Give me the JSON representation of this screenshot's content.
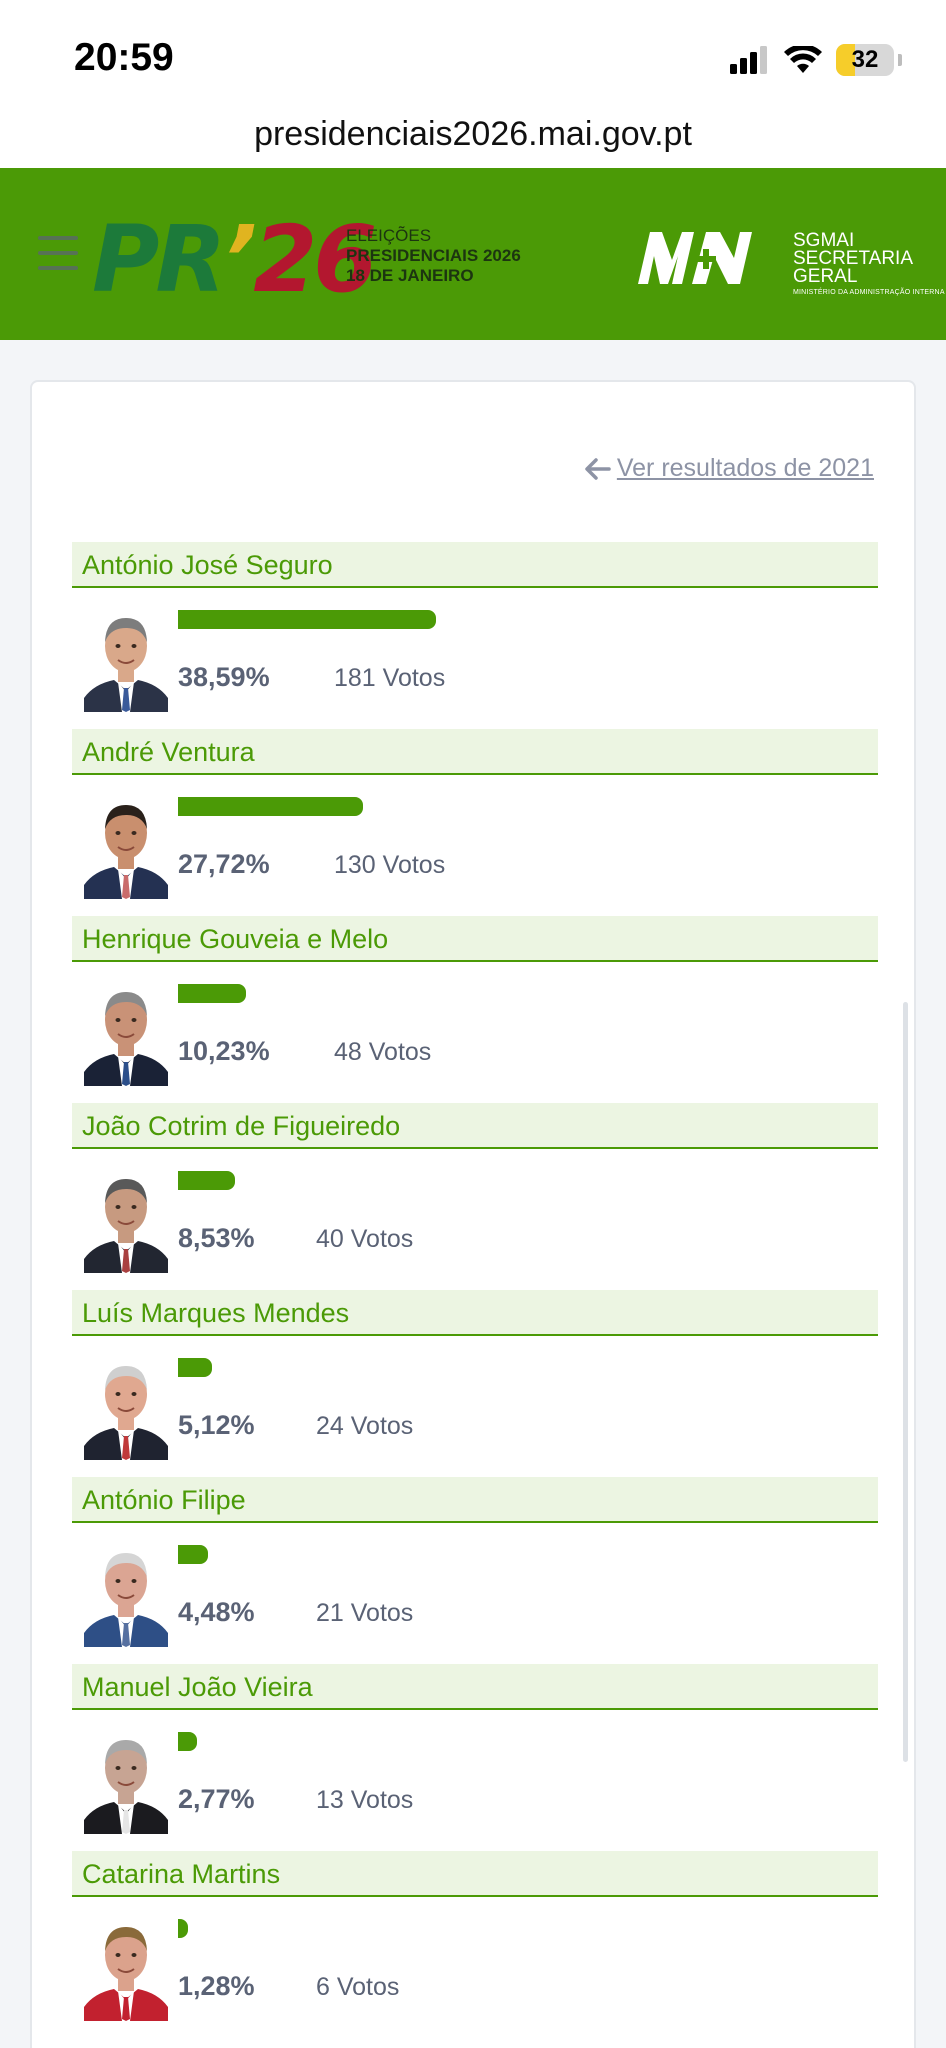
{
  "status_bar": {
    "time": "20:59",
    "battery": "32",
    "battery_level": 0.32
  },
  "url": "presidenciais2026.mai.gov.pt",
  "header": {
    "logo_pr": "PR",
    "logo_apostrophe": "’",
    "logo_year": "26",
    "logo_line1": "ELEIÇÕES",
    "logo_line2": "PRESIDENCIAIS 2026",
    "logo_line3": "18 DE JANEIRO",
    "sgmai_line1": "SGMAI",
    "sgmai_line2": "SECRETARIA",
    "sgmai_line3": "GERAL",
    "sgmai_line4": "MINISTÉRIO DA ADMINISTRAÇÃO INTERNA",
    "brand_color": "#4b9a06"
  },
  "back_link": "Ver resultados de 2021",
  "candidates": [
    {
      "name": "António José Seguro",
      "percent": "38,59%",
      "votes": "181 Votos",
      "share": 38.59,
      "suit": "#2b3347",
      "skin": "#d9a88a",
      "hair": "#7d7d7d",
      "tie": "#3a5a9a"
    },
    {
      "name": "André Ventura",
      "percent": "27,72%",
      "votes": "130 Votos",
      "share": 27.72,
      "suit": "#243152",
      "skin": "#c98f6e",
      "hair": "#2a211b",
      "tie": "#c96b6b"
    },
    {
      "name": "Henrique Gouveia e Melo",
      "percent": "10,23%",
      "votes": "48 Votos",
      "share": 10.23,
      "suit": "#1a2236",
      "skin": "#c99277",
      "hair": "#8a8a8a",
      "tie": "#2c4f8a"
    },
    {
      "name": "João Cotrim de Figueiredo",
      "percent": "8,53%",
      "votes": "40 Votos",
      "share": 8.53,
      "suit": "#222631",
      "skin": "#c79a80",
      "hair": "#595959",
      "tie": "#a94040"
    },
    {
      "name": "Luís Marques Mendes",
      "percent": "5,12%",
      "votes": "24 Votos",
      "share": 5.12,
      "suit": "#1f2330",
      "skin": "#e0a890",
      "hair": "#cfcfcf",
      "tie": "#c0393a"
    },
    {
      "name": "António Filipe",
      "percent": "4,48%",
      "votes": "21 Votos",
      "share": 4.48,
      "suit": "#2e4f86",
      "skin": "#dba593",
      "hair": "#d5d5d5",
      "tie": "#5670a0"
    },
    {
      "name": "Manuel João Vieira",
      "percent": "2,77%",
      "votes": "13 Votos",
      "share": 2.77,
      "suit": "#1b1b1f",
      "skin": "#c7a493",
      "hair": "#a9a9a9",
      "tie": "#e5e5e5"
    },
    {
      "name": "Catarina Martins",
      "percent": "1,28%",
      "votes": "6 Votos",
      "share": 1.28,
      "suit": "#c2212f",
      "skin": "#dba28c",
      "hair": "#8a6a3a",
      "tie": "#c2212f"
    }
  ]
}
